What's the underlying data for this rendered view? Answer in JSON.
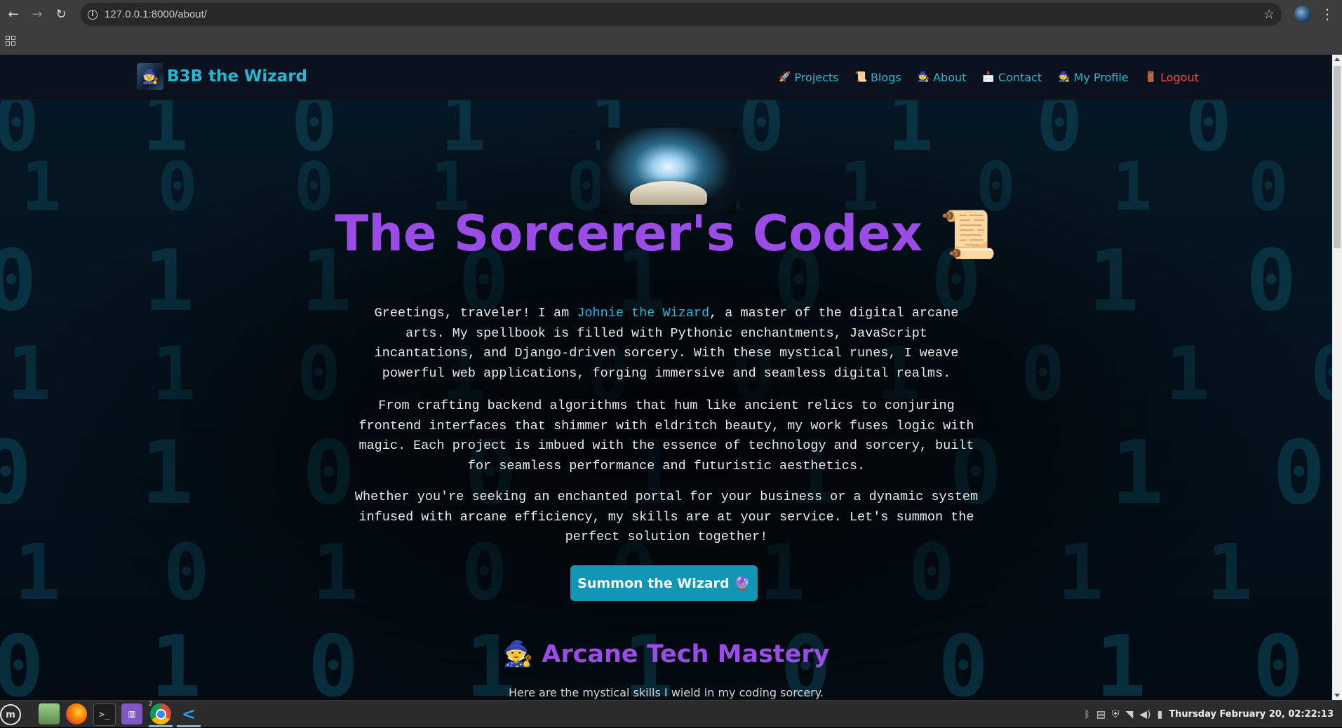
{
  "browser": {
    "url": "127.0.0.1:8000/about/",
    "back_icon": "←",
    "forward_icon": "→",
    "reload_icon": "↻",
    "star_icon": "☆",
    "menu_icon": "⋮"
  },
  "site": {
    "brand": "B3B the Wizard",
    "nav": [
      {
        "emoji": "🚀",
        "label": "Projects"
      },
      {
        "emoji": "📜",
        "label": "Blogs"
      },
      {
        "emoji": "🧙",
        "label": "About"
      },
      {
        "emoji": "📩",
        "label": "Contact"
      },
      {
        "emoji": "🧙",
        "label": "My Profile"
      },
      {
        "emoji": "🚪",
        "label": "Logout"
      }
    ]
  },
  "hero": {
    "title": "The Sorcerer's Codex",
    "title_emoji": "📜",
    "p1_before": "Greetings, traveler! I am ",
    "p1_highlight": "Johnie the Wizard",
    "p1_after": ", a master of the digital arcane arts. My spellbook is filled with Pythonic enchantments, JavaScript incantations, and Django-driven sorcery. With these mystical runes, I weave powerful web applications, forging immersive and seamless digital realms.",
    "p2": "From crafting backend algorithms that hum like ancient relics to conjuring frontend interfaces that shimmer with eldritch beauty, my work fuses logic with magic. Each project is imbued with the essence of technology and sorcery, built for seamless performance and futuristic aesthetics.",
    "p3": "Whether you're seeking an enchanted portal for your business or a dynamic system infused with arcane efficiency, my skills are at your service. Let's summon the perfect solution together!",
    "button": "Summon the Wizard 🔮"
  },
  "skills": {
    "emoji": "🧙",
    "title": "Arcane Tech Mastery",
    "subtitle": "Here are the mystical skills I wield in my coding sorcery."
  },
  "taskbar": {
    "clock": "Thursday February 20, 02:22:13",
    "chrome_badge": "2"
  },
  "colors": {
    "accent_cyan": "#22b8d6",
    "accent_purple": "#9c4ce6",
    "button": "#1296b6",
    "logout": "#e0554f"
  }
}
